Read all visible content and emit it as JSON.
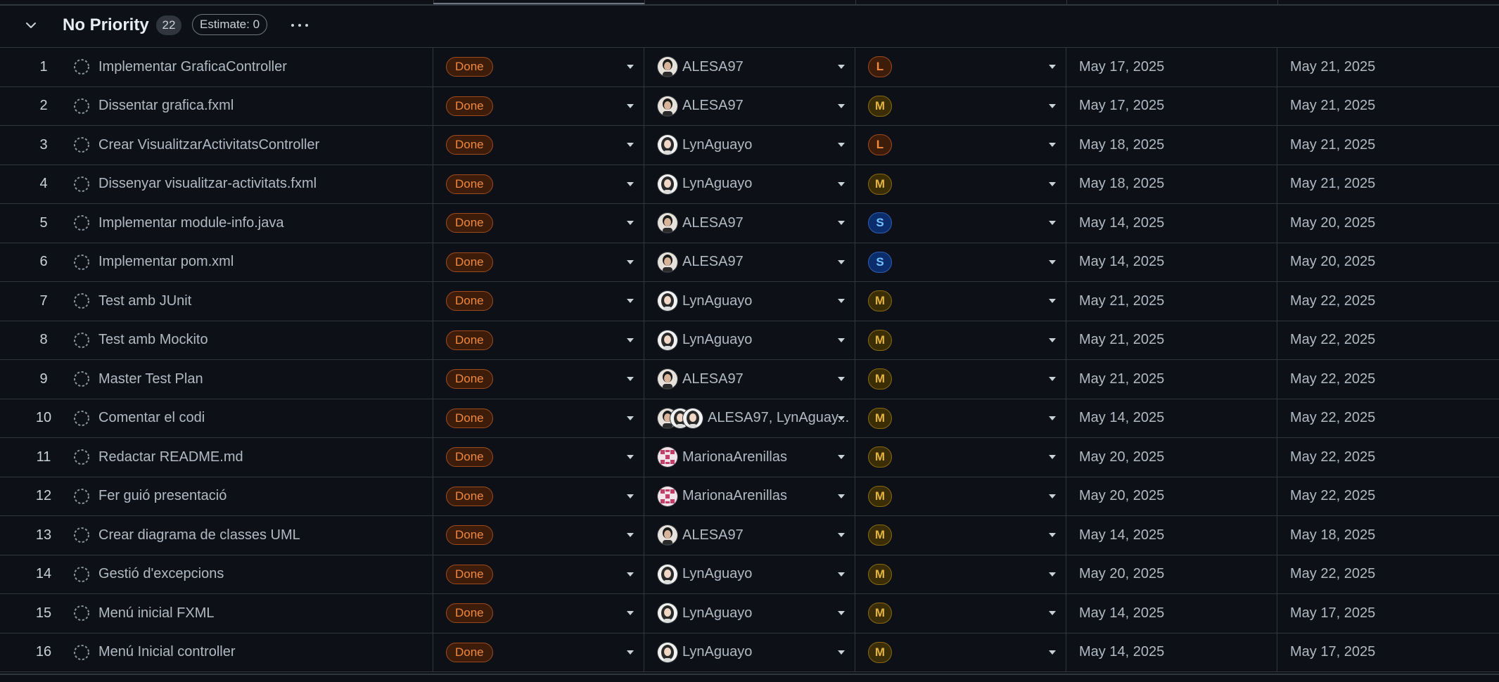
{
  "group": {
    "title": "No Priority",
    "count": "22",
    "estimate": "Estimate: 0"
  },
  "colors": {
    "background": "#0d1117",
    "border": "#30363d",
    "status_done": "#f0883e",
    "size_l": "#f0883e",
    "size_m": "#e3b341",
    "size_s": "#79c0ff"
  },
  "icons": {
    "collapse": "chevron-down-icon",
    "more": "kebab-horizontal-icon",
    "draft": "dashed-circle-icon",
    "dropdown": "triangle-down-icon"
  },
  "rows": [
    {
      "num": "1",
      "title": "Implementar GraficaController",
      "status": "Done",
      "assignee": "ALESA97",
      "avatar": "alesa",
      "size": "L",
      "start": "May 17, 2025",
      "end": "May 21, 2025"
    },
    {
      "num": "2",
      "title": "Dissentar grafica.fxml",
      "status": "Done",
      "assignee": "ALESA97",
      "avatar": "alesa",
      "size": "M",
      "start": "May 17, 2025",
      "end": "May 21, 2025"
    },
    {
      "num": "3",
      "title": "Crear VisualitzarActivitatsController",
      "status": "Done",
      "assignee": "LynAguayo",
      "avatar": "lyn",
      "size": "L",
      "start": "May 18, 2025",
      "end": "May 21, 2025"
    },
    {
      "num": "4",
      "title": "Dissenyar visualitzar-activitats.fxml",
      "status": "Done",
      "assignee": "LynAguayo",
      "avatar": "lyn",
      "size": "M",
      "start": "May 18, 2025",
      "end": "May 21, 2025"
    },
    {
      "num": "5",
      "title": "Implementar module-info.java",
      "status": "Done",
      "assignee": "ALESA97",
      "avatar": "alesa",
      "size": "S",
      "start": "May 14, 2025",
      "end": "May 20, 2025"
    },
    {
      "num": "6",
      "title": "Implementar pom.xml",
      "status": "Done",
      "assignee": "ALESA97",
      "avatar": "alesa",
      "size": "S",
      "start": "May 14, 2025",
      "end": "May 20, 2025"
    },
    {
      "num": "7",
      "title": "Test amb JUnit",
      "status": "Done",
      "assignee": "LynAguayo",
      "avatar": "lyn",
      "size": "M",
      "start": "May 21, 2025",
      "end": "May 22, 2025"
    },
    {
      "num": "8",
      "title": "Test amb Mockito",
      "status": "Done",
      "assignee": "LynAguayo",
      "avatar": "lyn",
      "size": "M",
      "start": "May 21, 2025",
      "end": "May 22, 2025"
    },
    {
      "num": "9",
      "title": "Master Test Plan",
      "status": "Done",
      "assignee": "ALESA97",
      "avatar": "alesa",
      "size": "M",
      "start": "May 21, 2025",
      "end": "May 22, 2025"
    },
    {
      "num": "10",
      "title": "Comentar el codi",
      "status": "Done",
      "assignee": "ALESA97, LynAguay...",
      "avatar": "both",
      "size": "M",
      "start": "May 14, 2025",
      "end": "May 22, 2025"
    },
    {
      "num": "11",
      "title": "Redactar README.md",
      "status": "Done",
      "assignee": "MarionaArenillas",
      "avatar": "mariona",
      "size": "M",
      "start": "May 20, 2025",
      "end": "May 22, 2025"
    },
    {
      "num": "12",
      "title": "Fer guió presentació",
      "status": "Done",
      "assignee": "MarionaArenillas",
      "avatar": "mariona",
      "size": "M",
      "start": "May 20, 2025",
      "end": "May 22, 2025"
    },
    {
      "num": "13",
      "title": "Crear diagrama de classes UML",
      "status": "Done",
      "assignee": "ALESA97",
      "avatar": "alesa",
      "size": "M",
      "start": "May 14, 2025",
      "end": "May 18, 2025"
    },
    {
      "num": "14",
      "title": "Gestió d'excepcions",
      "status": "Done",
      "assignee": "LynAguayo",
      "avatar": "lyn",
      "size": "M",
      "start": "May 20, 2025",
      "end": "May 22, 2025"
    },
    {
      "num": "15",
      "title": "Menú inicial FXML",
      "status": "Done",
      "assignee": "LynAguayo",
      "avatar": "lyn",
      "size": "M",
      "start": "May 14, 2025",
      "end": "May 17, 2025"
    },
    {
      "num": "16",
      "title": "Menú Inicial controller",
      "status": "Done",
      "assignee": "LynAguayo",
      "avatar": "lyn",
      "size": "M",
      "start": "May 14, 2025",
      "end": "May 17, 2025"
    }
  ]
}
